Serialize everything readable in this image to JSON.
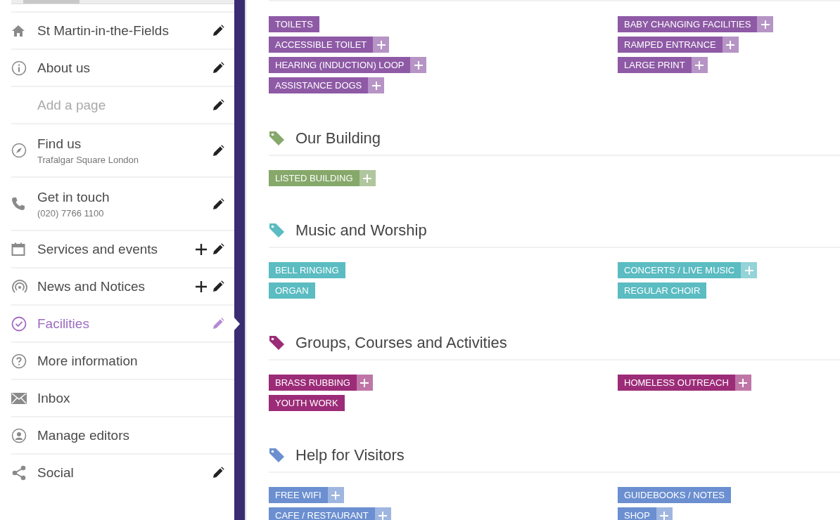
{
  "sidebar": {
    "items": [
      {
        "label": "St Martin-in-the-Fields",
        "muted": false,
        "addable": false,
        "editable": true,
        "selected": false
      },
      {
        "label": "About us",
        "muted": false,
        "addable": false,
        "editable": true,
        "selected": false
      },
      {
        "label": "Add a page",
        "muted": true,
        "addable": false,
        "editable": true,
        "selected": false
      },
      {
        "label": "Find us",
        "sublabel": "Trafalgar Square London",
        "muted": false,
        "addable": false,
        "editable": true,
        "selected": false
      },
      {
        "label": "Get in touch",
        "sublabel": "(020) 7766 1100",
        "muted": false,
        "addable": false,
        "editable": true,
        "selected": false
      },
      {
        "label": "Services and events",
        "muted": false,
        "addable": true,
        "editable": true,
        "selected": false
      },
      {
        "label": "News and Notices",
        "muted": false,
        "addable": true,
        "editable": true,
        "selected": false
      },
      {
        "label": "Facilities",
        "muted": false,
        "addable": false,
        "editable": true,
        "selected": true
      },
      {
        "label": "More information",
        "muted": false,
        "addable": false,
        "editable": false,
        "selected": false
      },
      {
        "label": "Inbox",
        "muted": false,
        "addable": false,
        "editable": false,
        "selected": false
      },
      {
        "label": "Manage editors",
        "muted": false,
        "addable": false,
        "editable": false,
        "selected": false
      },
      {
        "label": "Social",
        "muted": false,
        "addable": false,
        "editable": true,
        "selected": false
      }
    ]
  },
  "sections": [
    {
      "color": "#8e5aa5",
      "columns": [
        [
          {
            "label": "TOILETS",
            "addable": false
          },
          {
            "label": "ACCESSIBLE TOILET",
            "addable": true
          },
          {
            "label": "HEARING (INDUCTION) LOOP",
            "addable": true
          },
          {
            "label": "ASSISTANCE DOGS",
            "addable": true
          }
        ],
        [
          {
            "label": "BABY CHANGING FACILITIES",
            "addable": true
          },
          {
            "label": "RAMPED ENTRANCE",
            "addable": true
          },
          {
            "label": "LARGE PRINT",
            "addable": true
          }
        ]
      ]
    },
    {
      "title": "Our Building",
      "color": "#86a86a",
      "columns": [
        [
          {
            "label": "LISTED BUILDING",
            "addable": true
          }
        ],
        []
      ]
    },
    {
      "title": "Music and Worship",
      "color": "#5bbcc2",
      "columns": [
        [
          {
            "label": "BELL RINGING",
            "addable": false
          },
          {
            "label": "ORGAN",
            "addable": false
          }
        ],
        [
          {
            "label": "CONCERTS / LIVE MUSIC",
            "addable": true
          },
          {
            "label": "REGULAR CHOIR",
            "addable": false
          }
        ]
      ]
    },
    {
      "title": "Groups, Courses and Activities",
      "color": "#9c2c78",
      "columns": [
        [
          {
            "label": "BRASS RUBBING",
            "addable": true
          },
          {
            "label": "YOUTH WORK",
            "addable": false
          }
        ],
        [
          {
            "label": "HOMELESS OUTREACH",
            "addable": true
          }
        ]
      ]
    },
    {
      "title": "Help for Visitors",
      "color": "#6b8fd0",
      "columns": [
        [
          {
            "label": "FREE WIFI",
            "addable": true
          },
          {
            "label": "CAFE / RESTAURANT",
            "addable": true
          }
        ],
        [
          {
            "label": "GUIDEBOOKS / NOTES",
            "addable": false
          },
          {
            "label": "SHOP",
            "addable": true
          }
        ]
      ]
    }
  ]
}
